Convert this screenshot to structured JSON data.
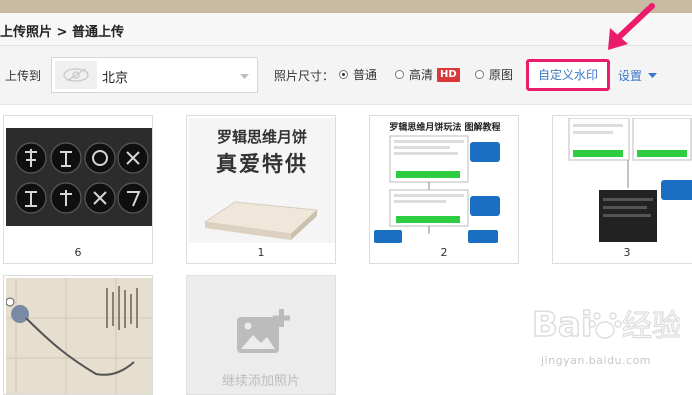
{
  "breadcrumb": "上传照片 > 普通上传",
  "toolbar": {
    "upload_to_label": "上传到",
    "album_name": "北京",
    "photo_size_label": "照片尺寸：",
    "size_options": [
      "普通",
      "高清",
      "原图"
    ],
    "selected_size": "普通",
    "hd_badge": "HD",
    "custom_watermark_button": "自定义水印",
    "settings_link": "设置"
  },
  "photos": [
    {
      "caption": "6"
    },
    {
      "caption": "1",
      "headline_1": "罗辑思维月饼",
      "headline_2": "真爱特供"
    },
    {
      "caption": "2",
      "headline": "罗辑思维月饼玩法 图解教程"
    },
    {
      "caption": "3"
    },
    {
      "caption": ""
    }
  ],
  "add_photo_label": "继续添加照片",
  "watermark_text": "jingyan.baidu.com",
  "colors": {
    "accent_pink": "#ea1c6b",
    "link_blue": "#3a78c8",
    "hd_red": "#d9373a"
  }
}
